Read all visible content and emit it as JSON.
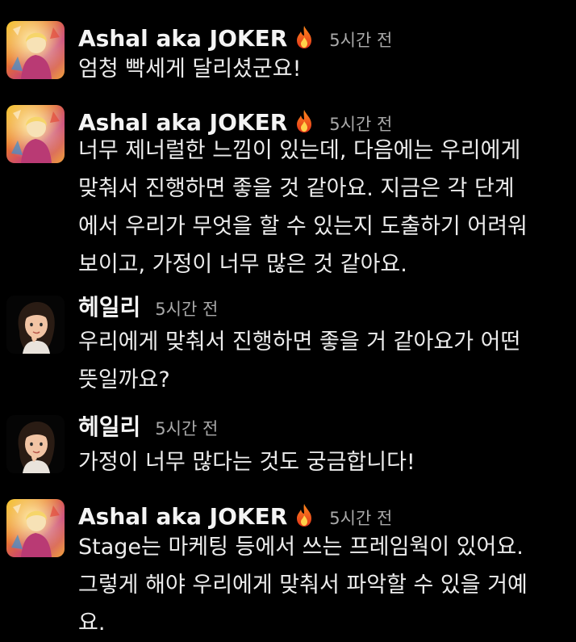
{
  "top_fragment": "^^^^^^^^^^^^^^",
  "messages": [
    {
      "author": "Ashal aka JOKER",
      "time": "5시간 전",
      "lines": [
        "엄청 빡세게 달리셨군요!"
      ]
    },
    {
      "author": "Ashal aka JOKER",
      "time": "5시간 전",
      "lines": [
        "너무 제너럴한 느낌이 있는데, 다음에는 우리에게",
        "맞춰서 진행하면 좋을 것 같아요. 지금은 각 단계",
        "에서 우리가 무엇을 할 수 있는지 도출하기 어려워",
        "보이고, 가정이 너무 많은 것 같아요."
      ]
    },
    {
      "author": "헤일리",
      "time": "5시간 전",
      "lines": [
        "우리에게 맞춰서 진행하면 좋을 거 같아요가 어떤",
        "뜻일까요?"
      ]
    },
    {
      "author": "헤일리",
      "time": "5시간 전",
      "lines": [
        "가정이 너무 많다는 것도 궁금합니다!"
      ]
    },
    {
      "author": "Ashal aka JOKER",
      "time": "5시간 전",
      "lines": [
        "Stage는 마케팅 등에서 쓰는 프레임웍이 있어요.",
        "그렇게 해야 우리에게 맞춰서 파악할 수 있을 거예",
        "요."
      ]
    }
  ],
  "icons": {
    "joker_status": "fire-icon",
    "joker_avatar": "colorful-portrait-avatar",
    "haley_avatar": "memoji-avatar"
  },
  "colors": {
    "background": "#000000",
    "text": "#ececec",
    "timestamp": "#a9a9a9"
  }
}
